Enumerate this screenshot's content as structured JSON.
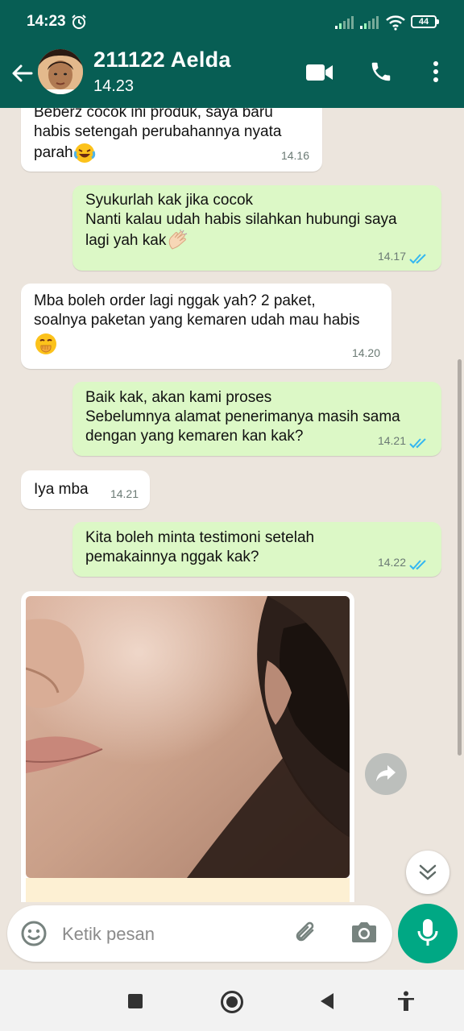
{
  "status_bar": {
    "time": "14:23",
    "battery": "44"
  },
  "header": {
    "contact_name": "211122 Aelda",
    "status": "14.23"
  },
  "messages": [
    {
      "dir": "in",
      "text": "Beberz cocok ini produk, saya baru\nhabis setengah perubahannya nyata\nparah",
      "emoji": "laughing-tears",
      "time": "14.16"
    },
    {
      "dir": "out",
      "text": "Syukurlah kak jika cocok\nNanti kalau udah habis silahkan hubungi saya\nlagi yah kak",
      "emoji": "clapping-hands",
      "time": "14.17",
      "read": true
    },
    {
      "dir": "in",
      "text": "Mba boleh order lagi nggak yah? 2 paket,\nsoalnya paketan yang kemaren udah mau habis",
      "emoji": "hand-over-mouth",
      "time": "14.20"
    },
    {
      "dir": "out",
      "text": "Baik kak, akan kami proses\nSebelumnya alamat penerimanya masih sama\ndengan yang kemaren kan kak?",
      "time": "14.21",
      "read": true
    },
    {
      "dir": "in",
      "text": "Iya mba",
      "time": "14.21"
    },
    {
      "dir": "out",
      "text": "Kita boleh minta testimoni setelah\npemakainnya nggak kak?",
      "time": "14.22",
      "read": true
    },
    {
      "dir": "in",
      "type": "image",
      "image": "close-up-face-skin-photo"
    }
  ],
  "composer": {
    "placeholder": "Ketik pesan"
  },
  "colors": {
    "header": "#075e54",
    "chat_bg": "#ece5dd",
    "outgoing": "#dcf8c6",
    "incoming": "#ffffff",
    "tick_read": "#34b7f1",
    "mic": "#00a884"
  }
}
